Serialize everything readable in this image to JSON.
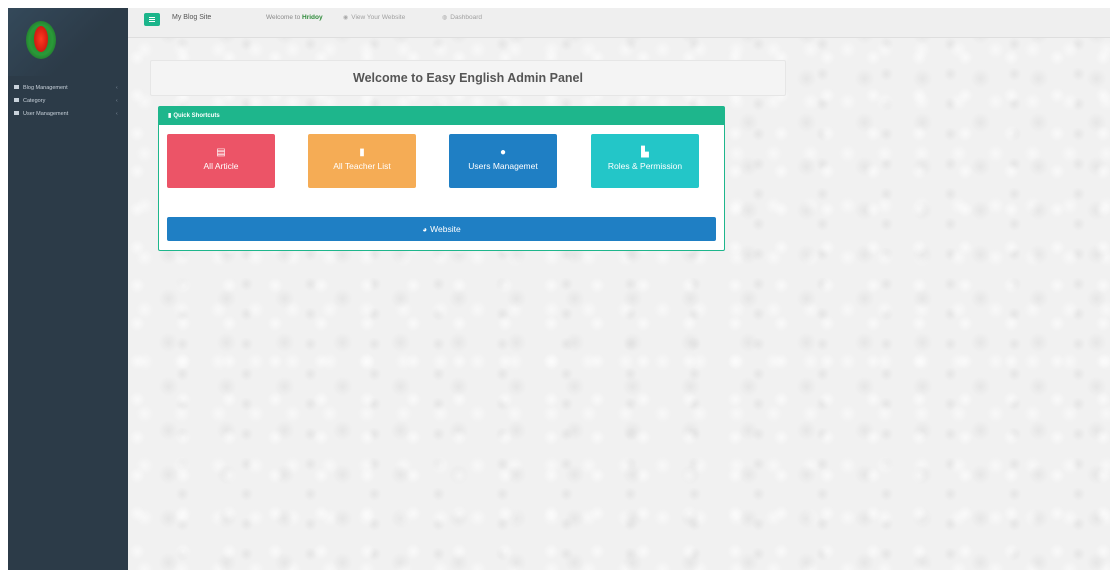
{
  "sidebar": {
    "logo_icon": "watermelon-logo",
    "items": [
      {
        "label": "Blog Management",
        "icon": "grid-icon",
        "chevron": "‹"
      },
      {
        "label": "Category",
        "icon": "grid-icon",
        "chevron": "‹"
      },
      {
        "label": "User Management",
        "icon": "grid-icon",
        "chevron": "‹"
      }
    ],
    "background": "#2c3b48"
  },
  "topbar": {
    "menu_icon": "hamburger-icon",
    "site_name": "My Blog Site",
    "welcome_prefix": "Welcome to",
    "user_name": "Hridoy",
    "view_website_label": "View Your Website",
    "view_website_icon": "eye-icon",
    "dashboard_label": "Dashboard",
    "dashboard_icon": "dashboard-icon"
  },
  "main": {
    "heading": "Welcome to Easy English Admin Panel",
    "panel": {
      "title": "Quick Shortcuts",
      "title_icon": "bookmark-icon",
      "tiles": [
        {
          "label": "All Article",
          "icon": "calendar-icon",
          "color": "#ec5467"
        },
        {
          "label": "All Teacher List",
          "icon": "bookmark-icon",
          "color": "#f5ac55"
        },
        {
          "label": "Users Managemet",
          "icon": "user-icon",
          "color": "#1f7fc4"
        },
        {
          "label": "Roles & Permission",
          "icon": "file-icon",
          "color": "#23c6c8"
        }
      ],
      "website_button": {
        "label": "Website",
        "icon": "globe-icon",
        "color": "#1f7fc4"
      }
    },
    "accent": "#1eb68c"
  }
}
